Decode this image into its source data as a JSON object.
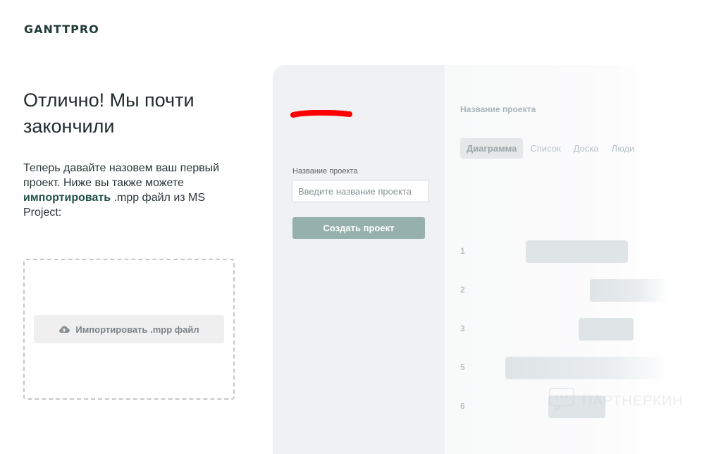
{
  "logo": {
    "text": "GANTTPRO"
  },
  "left": {
    "heading": "Отлично! Мы почти закончили",
    "intro_before": "Теперь давайте назовем ваш первый проект. Ниже вы также можете ",
    "intro_link": "импортировать",
    "intro_after": " .mpp файл из MS Project:",
    "import_button": {
      "label": "Импортировать .mpp файл",
      "icon": "cloud-upload-icon"
    }
  },
  "form": {
    "label": "Название проекта",
    "placeholder": "Введите название проекта",
    "value": "",
    "submit_label": "Создать проект"
  },
  "preview": {
    "title": "Название проекта",
    "tabs": [
      {
        "label": "Диаграмма",
        "active": true
      },
      {
        "label": "Список",
        "active": false
      },
      {
        "label": "Доска",
        "active": false
      },
      {
        "label": "Люди",
        "active": false
      }
    ],
    "rows": [
      "1",
      "2",
      "3",
      "5",
      "6"
    ]
  },
  "watermark": {
    "text": "ПАРТНЕРКИН"
  },
  "colors": {
    "brand": "#1f3b34",
    "link": "#1f5247",
    "button": "#96b1ad",
    "panel_left": "#eff1f2",
    "red_mark": "#ff0000"
  }
}
